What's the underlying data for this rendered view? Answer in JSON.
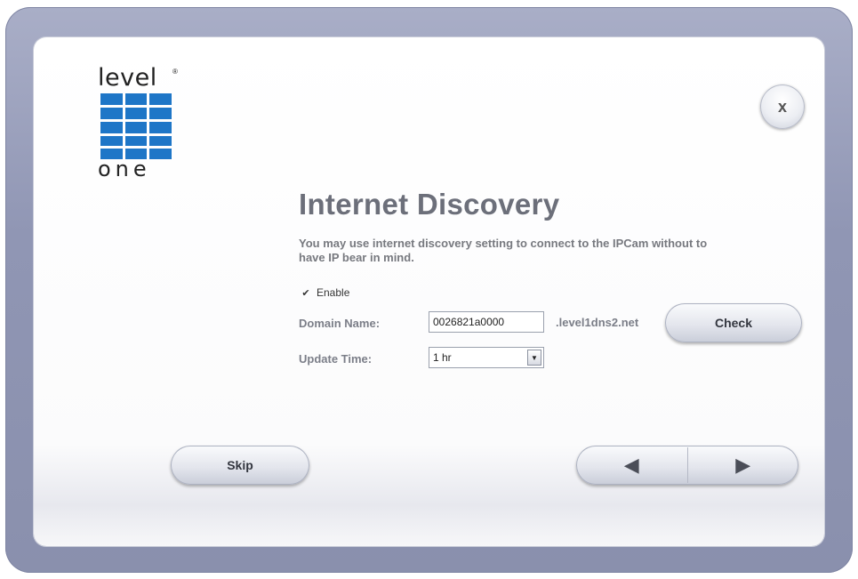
{
  "logo": {
    "top_text": "level",
    "reg_mark": "®",
    "bottom_text": "one",
    "color": "#1e76c7"
  },
  "close_button": {
    "glyph": "x"
  },
  "title": "Internet Discovery",
  "description": "You may use internet discovery setting to connect to the IPCam without to have IP bear in mind.",
  "enable": {
    "label": "Enable",
    "checked_glyph": "✔"
  },
  "domain": {
    "label": "Domain Name:",
    "value": "0026821a0000",
    "suffix": ".level1dns2.net",
    "check_label": "Check"
  },
  "update_time": {
    "label": "Update Time:",
    "selected": "1 hr",
    "arrow_glyph": "▼"
  },
  "footer": {
    "skip_label": "Skip",
    "prev_glyph": "◀",
    "next_glyph": "▶"
  }
}
